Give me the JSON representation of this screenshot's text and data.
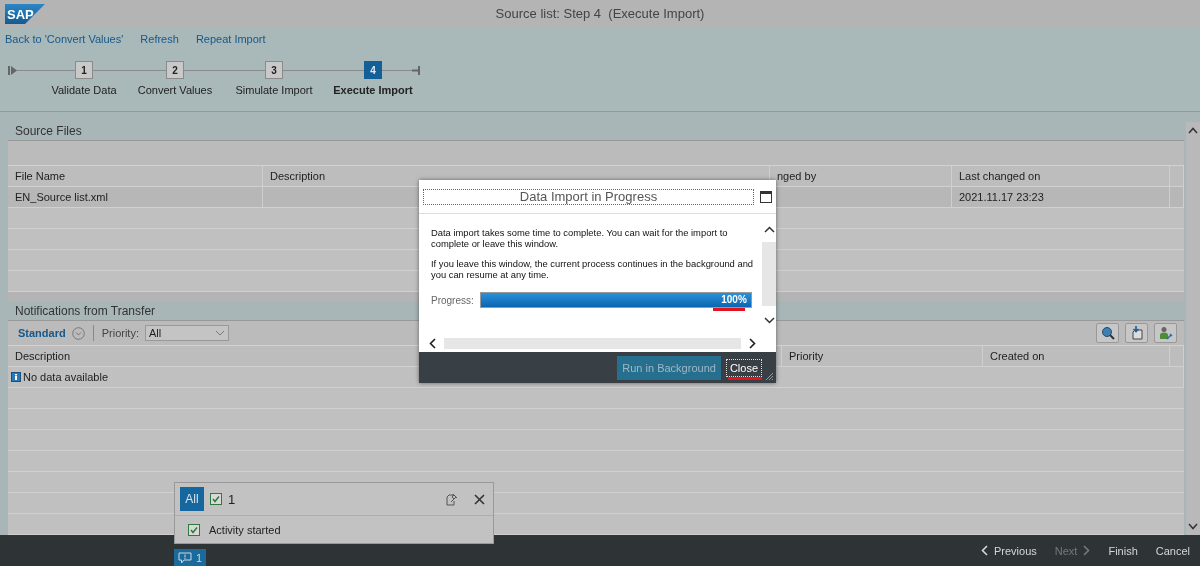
{
  "header": {
    "logo_text": "SAP",
    "title": "Source list: Step 4  (Execute Import)"
  },
  "links": [
    "Back to 'Convert Values'",
    "Refresh",
    "Repeat Import"
  ],
  "steps": [
    {
      "number": "1",
      "label": "Validate Data",
      "selected": false
    },
    {
      "number": "2",
      "label": "Convert Values",
      "selected": false
    },
    {
      "number": "3",
      "label": "Simulate Import",
      "selected": false
    },
    {
      "number": "4",
      "label": "Execute Import",
      "selected": true
    }
  ],
  "source_files": {
    "title": "Source Files",
    "columns": [
      "File Name",
      "Description",
      "nged by",
      "Last changed on"
    ],
    "rows": [
      {
        "file_name": "EN_Source list.xml",
        "last_changed_on": "2021.11.17 23:23"
      }
    ]
  },
  "notifications": {
    "title": "Notifications from Transfer",
    "variant": "Standard",
    "priority_label": "Priority:",
    "priority_value": "All",
    "columns": [
      "Description",
      "Priority",
      "Created on"
    ],
    "empty_message": "No data available"
  },
  "dialog": {
    "title": "Data Import in Progress",
    "paragraphs": [
      "Data import takes some time to complete. You can wait for the import to complete or leave this window.",
      "If you leave this window, the current process continues in the background and you can resume at any time."
    ],
    "progress_label": "Progress:",
    "progress": {
      "level": 1,
      "reading": "100%"
    },
    "buttons": [
      {
        "label": "Run in Background",
        "kind": "primary"
      },
      {
        "label": "Close",
        "kind": "focused"
      }
    ]
  },
  "message_popover": {
    "filter": "All",
    "count": "1",
    "messages": [
      {
        "text": "Activity started"
      }
    ]
  },
  "message_badge": {
    "count": "1"
  },
  "footer_buttons": [
    {
      "label": "Previous",
      "disabled": false,
      "kind": "back"
    },
    {
      "label": "Next",
      "disabled": true,
      "kind": "forward"
    },
    {
      "label": "Finish",
      "disabled": false
    },
    {
      "label": "Cancel",
      "disabled": false
    }
  ]
}
